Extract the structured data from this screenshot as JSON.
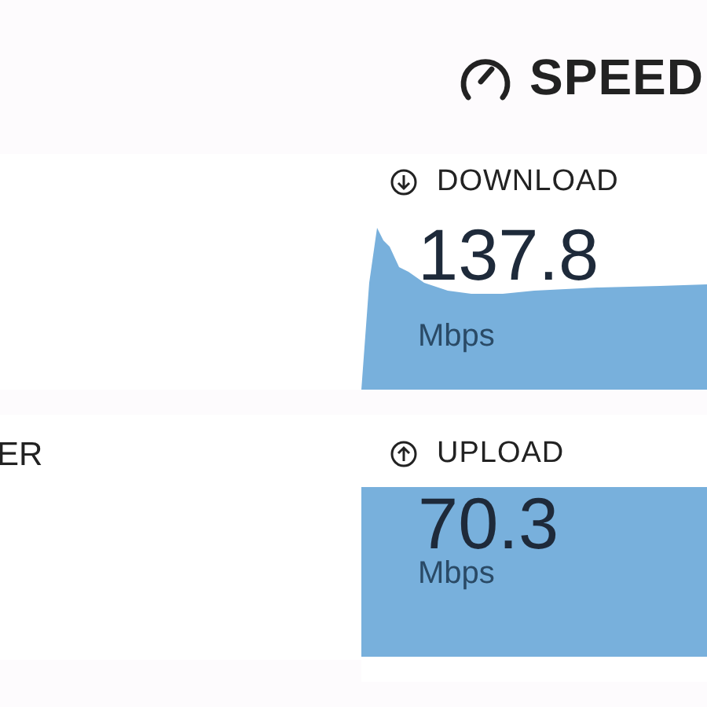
{
  "header": {
    "brand": "SPEED"
  },
  "side_label": "ER",
  "results": [
    {
      "kind": "download",
      "label": "DOWNLOAD",
      "value": "137.8",
      "unit": "Mbps"
    },
    {
      "kind": "upload",
      "label": "UPLOAD",
      "value": "70.3",
      "unit": "Mbps"
    }
  ]
}
